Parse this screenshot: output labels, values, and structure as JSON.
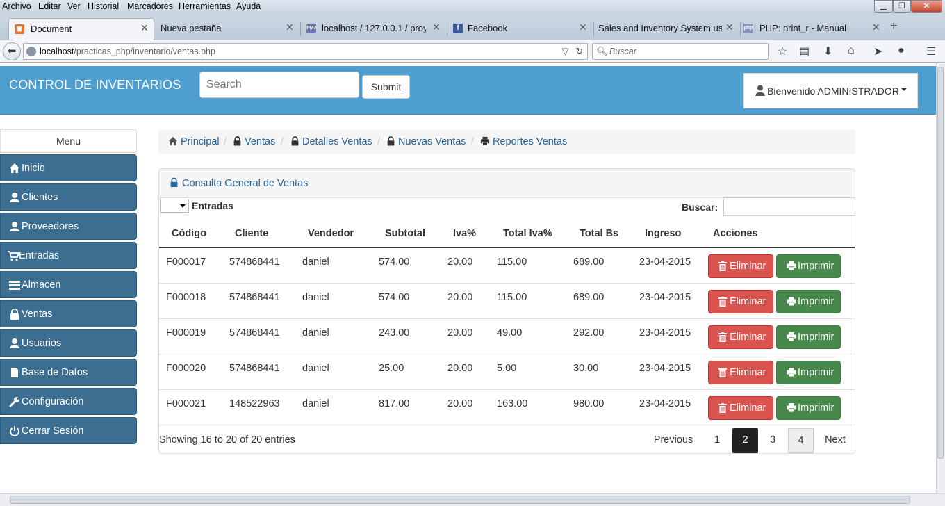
{
  "browser": {
    "menu": [
      "Archivo",
      "Editar",
      "Ver",
      "Historial",
      "Marcadores",
      "Herramientas",
      "Ayuda"
    ],
    "tabs": [
      {
        "label": "Document",
        "icon": "html-file-icon",
        "active": true
      },
      {
        "label": "Nueva pestaña",
        "icon": "none"
      },
      {
        "label": "localhost / 127.0.0.1 / proy...",
        "icon": "phpmyadmin-icon"
      },
      {
        "label": "Facebook",
        "icon": "facebook-icon"
      },
      {
        "label": "Sales and Inventory System usi...",
        "icon": "none"
      },
      {
        "label": "PHP: print_r - Manual",
        "icon": "php-icon"
      }
    ],
    "new_tab": "+",
    "url_host": "localhost",
    "url_path": "/practicas_php/inventario/ventas.php",
    "search_placeholder": "Buscar"
  },
  "header": {
    "brand": "CONTROL DE INVENTARIOS",
    "search_placeholder": "Search",
    "submit_label": "Submit",
    "user_label": "Bienvenido ADMINISTRADOR"
  },
  "sidebar": {
    "title": "Menu",
    "items": [
      {
        "label": "Inicio",
        "icon": "home-icon"
      },
      {
        "label": "Clientes",
        "icon": "user-icon"
      },
      {
        "label": "Proveedores",
        "icon": "user-icon"
      },
      {
        "label": "Entradas",
        "icon": "cart-icon"
      },
      {
        "label": "Almacen",
        "icon": "list-icon"
      },
      {
        "label": "Ventas",
        "icon": "lock-icon"
      },
      {
        "label": "Usuarios",
        "icon": "user-icon"
      },
      {
        "label": "Base de Datos",
        "icon": "file-icon"
      },
      {
        "label": "Configuración",
        "icon": "wrench-icon"
      },
      {
        "label": "Cerrar Sesión",
        "icon": "power-icon"
      }
    ]
  },
  "breadcrumb": [
    {
      "label": "Principal",
      "icon": "home-icon"
    },
    {
      "label": "Ventas",
      "icon": "lock-icon"
    },
    {
      "label": "Detalles Ventas",
      "icon": "lock-icon"
    },
    {
      "label": "Nuevas Ventas",
      "icon": "lock-icon"
    },
    {
      "label": "Reportes Ventas",
      "icon": "print-icon"
    }
  ],
  "panel": {
    "title": "Consulta General de Ventas",
    "entries_label": "Entradas",
    "search_label": "Buscar:",
    "columns": [
      "Código",
      "Cliente",
      "Vendedor",
      "Subtotal",
      "Iva%",
      "Total Iva%",
      "Total Bs",
      "Ingreso",
      "Acciones"
    ],
    "rows": [
      [
        "F000017",
        "574868441",
        "daniel",
        "574.00",
        "20.00",
        "115.00",
        "689.00",
        "23-04-2015"
      ],
      [
        "F000018",
        "574868441",
        "daniel",
        "574.00",
        "20.00",
        "115.00",
        "689.00",
        "23-04-2015"
      ],
      [
        "F000019",
        "574868441",
        "daniel",
        "243.00",
        "20.00",
        "49.00",
        "292.00",
        "23-04-2015"
      ],
      [
        "F000020",
        "574868441",
        "daniel",
        "25.00",
        "20.00",
        "5.00",
        "30.00",
        "23-04-2015"
      ],
      [
        "F000021",
        "148522963",
        "daniel",
        "817.00",
        "20.00",
        "163.00",
        "980.00",
        "23-04-2015"
      ]
    ],
    "delete_label": "Eliminar",
    "print_label": "Imprimir",
    "showing": "Showing 16 to 20 of 20 entries",
    "pagination": {
      "previous": "Previous",
      "pages": [
        "1",
        "2",
        "3",
        "4"
      ],
      "current": "2",
      "next": "Next"
    }
  },
  "colors": {
    "header_bg": "#4e9fd0",
    "sidebar_item": "#3c6e91",
    "danger": "#d9534f",
    "success": "#47894b",
    "link": "#2a6496"
  }
}
